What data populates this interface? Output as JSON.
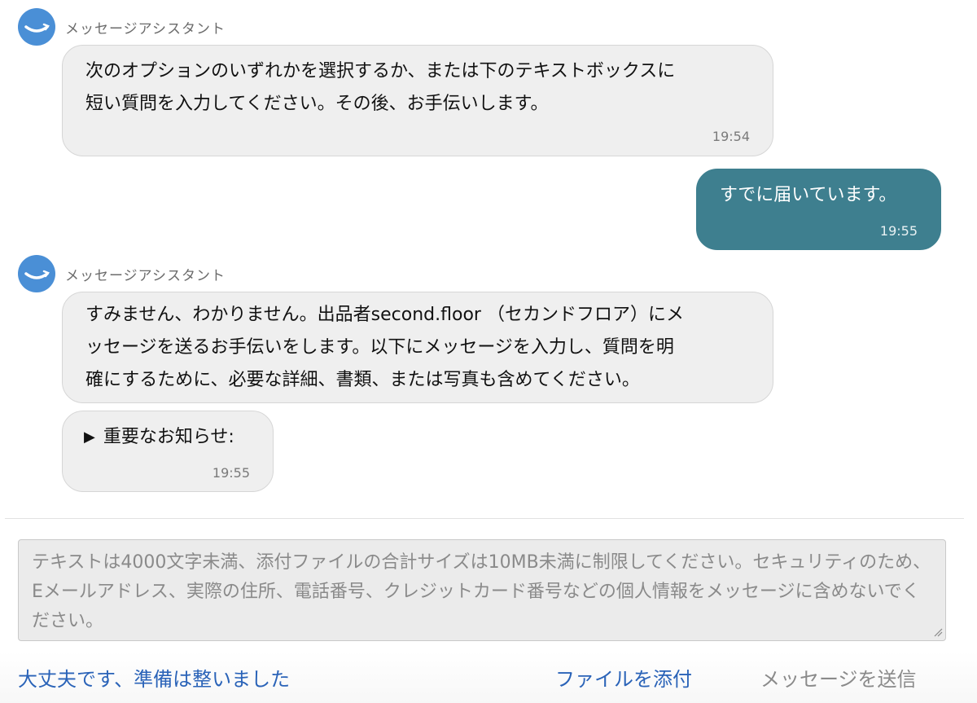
{
  "assistant": {
    "name": "メッセージアシスタント"
  },
  "messages": [
    {
      "from": "assistant",
      "lines": [
        "次のオプションのいずれかを選択するか、または下のテキストボックスに",
        "短い質問を入力してください。その後、お手伝いします。"
      ],
      "time": "19:54"
    },
    {
      "from": "user",
      "text": "すでに届いています。",
      "time": "19:55"
    },
    {
      "from": "assistant",
      "lines": [
        "すみません、わかりません。出品者second.floor （セカンドフロア）にメ",
        "ッセージを送るお手伝いをします。以下にメッセージを入力し、質問を明",
        "確にするために、必要な詳細、書類、または写真も含めてください。"
      ]
    },
    {
      "from": "assistant",
      "expander": "▶",
      "text": "重要なお知らせ:",
      "time": "19:55"
    }
  ],
  "composer": {
    "placeholder": "テキストは4000文字未満、添付ファイルの合計サイズは10MB未満に制限してください。セキュリティのため、Eメールアドレス、実際の住所、電話番号、クレジットカード番号などの個人情報をメッセージに含めないでください。"
  },
  "actions": {
    "ready": "大丈夫です、準備は整いました",
    "attach": "ファイルを添付",
    "send": "メッセージを送信"
  },
  "colors": {
    "user_bubble": "#3e7f8f",
    "assistant_bubble": "#efefef",
    "link": "#2a63b8",
    "avatar": "#4a8fd6"
  },
  "icons": {
    "avatar": "smile-logo-icon",
    "expander": "triangle-right-icon",
    "resize": "resize-grip-icon"
  }
}
